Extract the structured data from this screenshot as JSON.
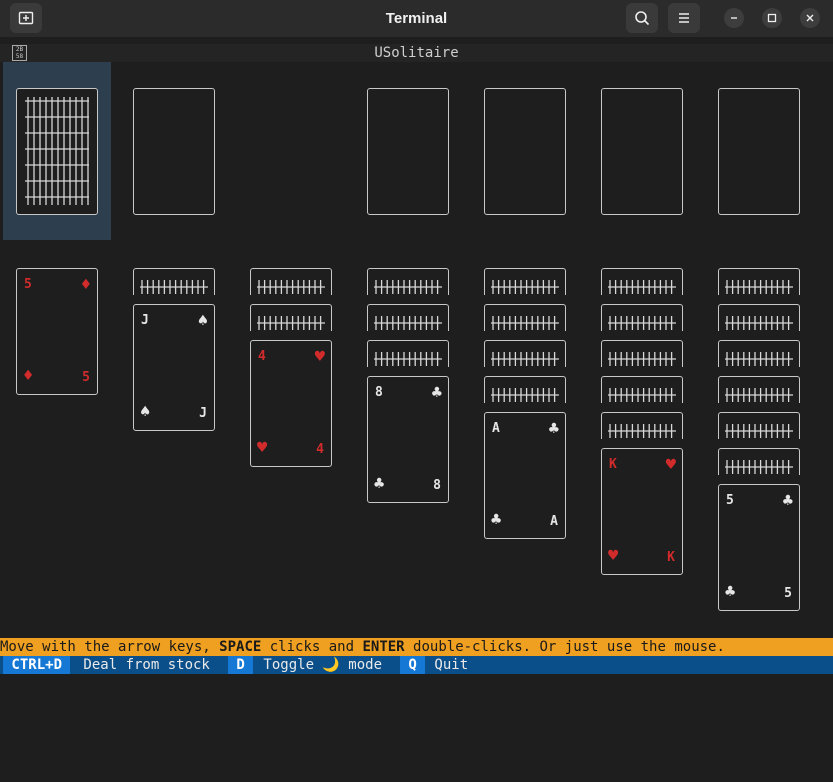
{
  "window": {
    "title": "Terminal"
  },
  "app": {
    "title": "USolitaire",
    "icon_name": "cards-app-icon"
  },
  "colors": {
    "red_suit": "#d12b2b",
    "black_suit": "#e6e6e6",
    "hint_bar": "#f0a020",
    "key_bar": "#0b4f8a",
    "key_highlight": "#1478d4"
  },
  "stock": {
    "face_down": true
  },
  "waste": {
    "empty": true
  },
  "foundations": [
    {
      "empty": true
    },
    {
      "empty": true
    },
    {
      "empty": true
    },
    {
      "empty": true
    }
  ],
  "tableau": [
    {
      "hidden": 0,
      "rank": "5",
      "suit": "♦",
      "color": "red"
    },
    {
      "hidden": 1,
      "rank": "J",
      "suit": "♠",
      "color": "black"
    },
    {
      "hidden": 2,
      "rank": "4",
      "suit": "♥",
      "color": "red"
    },
    {
      "hidden": 3,
      "rank": "8",
      "suit": "♣",
      "color": "black"
    },
    {
      "hidden": 4,
      "rank": "A",
      "suit": "♣",
      "color": "black"
    },
    {
      "hidden": 5,
      "rank": "K",
      "suit": "♥",
      "color": "red"
    },
    {
      "hidden": 6,
      "rank": "5",
      "suit": "♣",
      "color": "black"
    }
  ],
  "hint": {
    "p1": "Move with the arrow keys, ",
    "k1": "SPACE",
    "p2": " clicks and ",
    "k2": "ENTER",
    "p3": " double-clicks. Or just use the mouse."
  },
  "keys": {
    "k1": " CTRL+D ",
    "a1": " Deal from stock ",
    "k2": " D ",
    "a2": " Toggle 🌙 mode ",
    "k3": " Q ",
    "a3": " Quit "
  }
}
